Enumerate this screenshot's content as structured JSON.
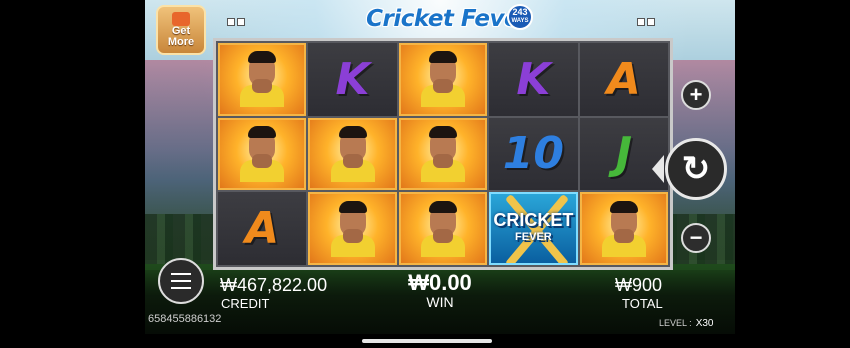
{
  "logo": {
    "title": "Cricket Fever",
    "ways_number": "243",
    "ways_label": "WAYS"
  },
  "get_more": {
    "label_line1": "Get",
    "label_line2": "More"
  },
  "reels": [
    [
      {
        "type": "player"
      },
      {
        "type": "letter",
        "value": "K",
        "color": "#8b3fd6"
      },
      {
        "type": "player"
      },
      {
        "type": "letter",
        "value": "K",
        "color": "#8b3fd6"
      },
      {
        "type": "letter",
        "value": "A",
        "color": "#f08a1c"
      }
    ],
    [
      {
        "type": "player"
      },
      {
        "type": "player"
      },
      {
        "type": "player"
      },
      {
        "type": "letter",
        "value": "10",
        "color": "#2e7fe0"
      },
      {
        "type": "letter",
        "value": "J",
        "color": "#46b83a"
      }
    ],
    [
      {
        "type": "letter",
        "value": "A",
        "color": "#f08a1c"
      },
      {
        "type": "player"
      },
      {
        "type": "player"
      },
      {
        "type": "wild",
        "value": "CRICKET",
        "sub": "FEVER"
      },
      {
        "type": "player"
      }
    ]
  ],
  "controls": {
    "plus": "+",
    "minus": "−",
    "spin": "↻"
  },
  "credit": {
    "value": "₩467,822.00",
    "label": "CREDIT"
  },
  "win": {
    "value": "₩0.00",
    "label": "WIN"
  },
  "total": {
    "value": "₩900",
    "label": "TOTAL"
  },
  "game_id": "658455886132",
  "level": {
    "label": "LEVEL :",
    "value": "X30"
  }
}
